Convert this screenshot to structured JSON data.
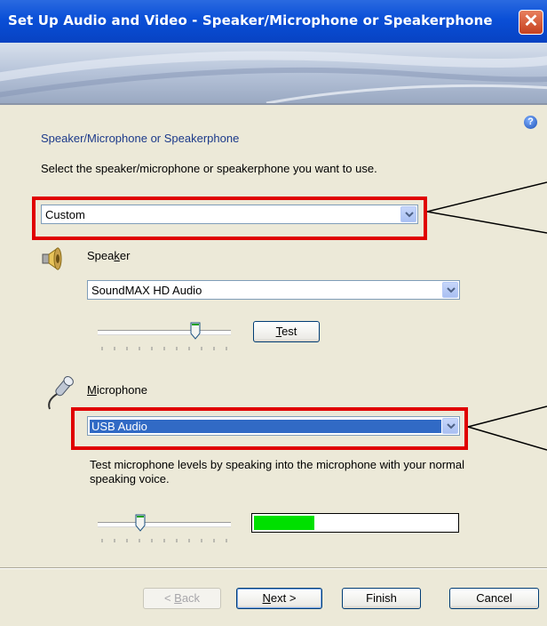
{
  "window": {
    "title": "Set Up Audio and Video - Speaker/Microphone or Speakerphone"
  },
  "page": {
    "heading": "Speaker/Microphone or Speakerphone",
    "instruction": "Select the speaker/microphone or speakerphone you want to use."
  },
  "device_select": {
    "value": "Custom"
  },
  "speaker": {
    "label_pre": "Spea",
    "label_accel": "k",
    "label_post": "er",
    "device": "SoundMAX HD Audio",
    "volume_level": 0.85,
    "test_accel": "T",
    "test_rest": "est"
  },
  "microphone": {
    "label_accel": "M",
    "label_post": "icrophone",
    "device": "USB Audio",
    "note": "Test microphone levels by speaking into the microphone with your normal speaking voice.",
    "volume_level": 0.35,
    "input_level": 0.3
  },
  "footer": {
    "back_prefix": "< ",
    "back_accel": "B",
    "back_rest": "ack",
    "next_accel": "N",
    "next_rest": "ext >",
    "finish": "Finish",
    "cancel": "Cancel"
  },
  "colors": {
    "highlight": "#e00000",
    "titlebar": "#0a4fd7",
    "level": "#00e000"
  },
  "icons": [
    "close-icon",
    "help-icon",
    "speaker-icon",
    "microphone-icon",
    "chevron-down-icon"
  ]
}
